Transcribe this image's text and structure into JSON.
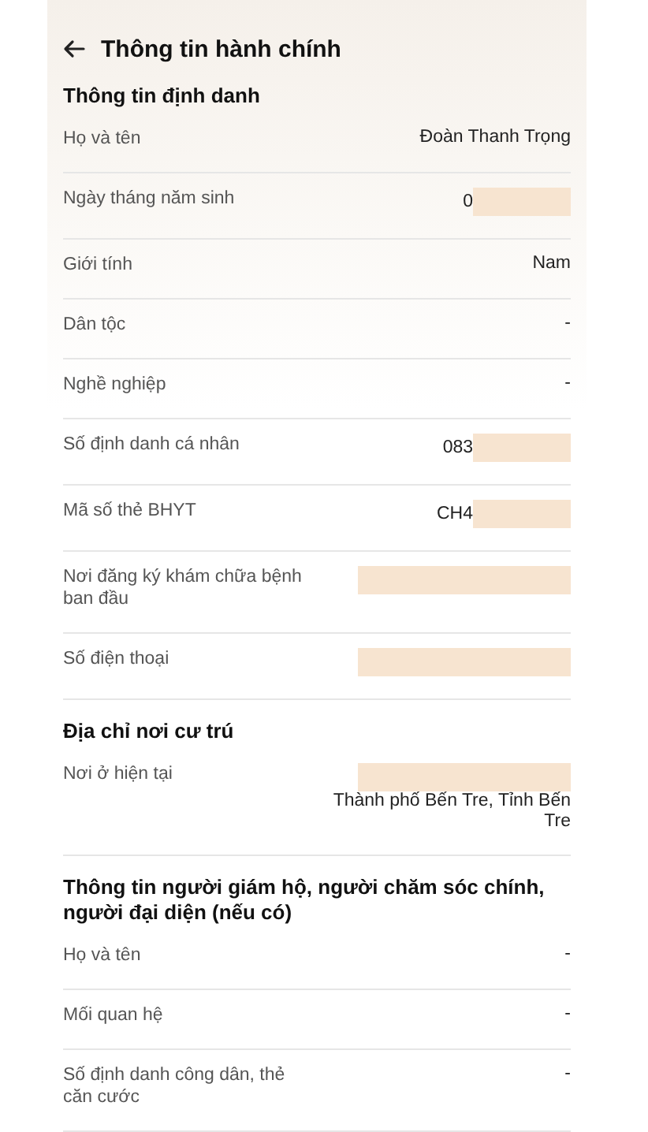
{
  "header": {
    "title": "Thông tin hành chính"
  },
  "sections": [
    {
      "title": "Thông tin định danh",
      "rows": [
        {
          "label": "Họ và tên",
          "value": "Đoàn Thanh Trọng",
          "redacted": false
        },
        {
          "label": "Ngày tháng năm sinh",
          "value": "0",
          "redacted": true
        },
        {
          "label": "Giới tính",
          "value": "Nam",
          "redacted": false
        },
        {
          "label": "Dân tộc",
          "value": "-",
          "redacted": false
        },
        {
          "label": "Nghề nghiệp",
          "value": "-",
          "redacted": false
        },
        {
          "label": "Số định danh cá nhân",
          "value": "083",
          "redacted": true
        },
        {
          "label": "Mã số thẻ BHYT",
          "value": "CH4",
          "redacted": true
        },
        {
          "label": "Nơi đăng ký khám chữa bệnh ban đầu",
          "redacted": true
        },
        {
          "label": "Số điện thoại",
          "redacted": true
        }
      ]
    },
    {
      "title": "Địa chỉ nơi cư trú",
      "rows": [
        {
          "label": "Nơi ở hiện tại",
          "value": "Thành phố Bến Tre, Tỉnh Bến Tre",
          "redacted": true,
          "block_above": true
        }
      ]
    },
    {
      "title": "Thông tin người giám hộ, người chăm sóc chính, người đại diện (nếu có)",
      "rows": [
        {
          "label": "Họ và tên",
          "value": "-",
          "redacted": false
        },
        {
          "label": "Mối quan hệ",
          "value": "-",
          "redacted": false
        },
        {
          "label": "Số định danh công dân, thẻ căn cước",
          "value": "-",
          "redacted": false
        }
      ]
    }
  ]
}
